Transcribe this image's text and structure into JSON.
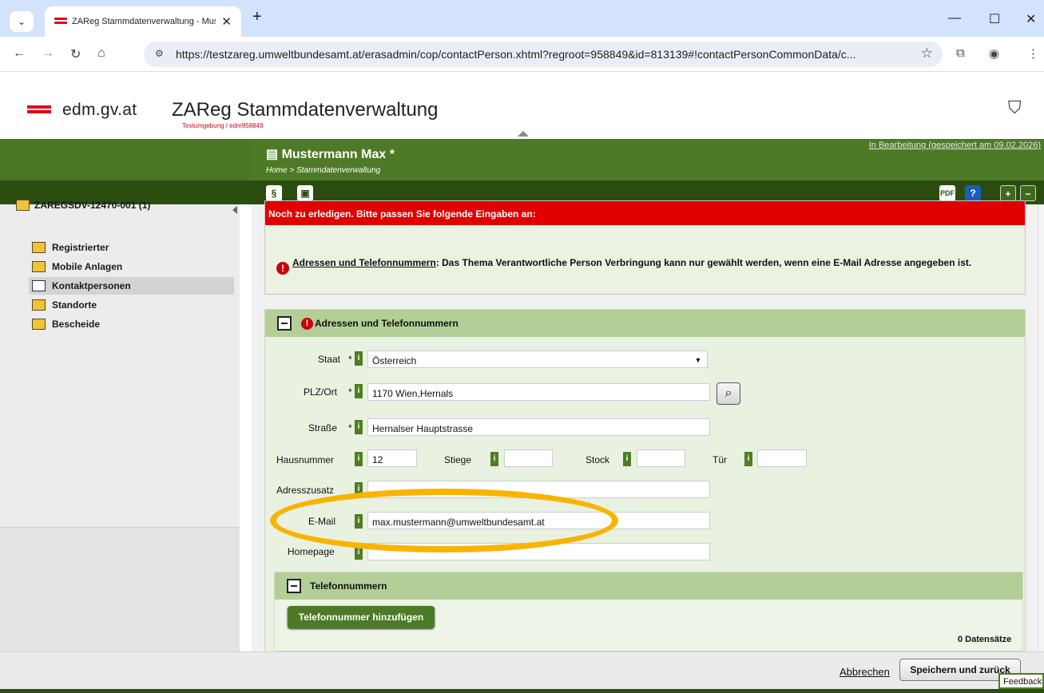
{
  "browser": {
    "tab_title": "ZAReg Stammdatenverwaltung - Must",
    "url": "https://testzareg.umweltbundesamt.at/erasadmin/cop/contactPerson.xhtml?regroot=958849&id=813139#!contactPersonCommonData/c..."
  },
  "header": {
    "brand": "edm.gv.at",
    "app_title": "ZAReg Stammdatenverwaltung",
    "app_subtitle": "Testumgebung / edm958849"
  },
  "page": {
    "title": "Mustermann Max *",
    "breadcrumb": "Home > Stammdatenverwaltung",
    "status": "In Bearbeitung (gespeichert am 09.02.2026)"
  },
  "toolbar": {
    "paragraph_icon": "paragraph-icon",
    "save_icon": "save-icon",
    "pdf_icon": "pdf-icon",
    "help_icon": "help-icon",
    "expand_icon": "expand-icon",
    "collapse_icon": "collapse-icon"
  },
  "sidebar": {
    "root": "ZAREGSDV-12470-001 (1)",
    "items": [
      {
        "label": "Registrierter"
      },
      {
        "label": "Mobile Anlagen"
      },
      {
        "label": "Kontaktpersonen"
      },
      {
        "label": "Standorte"
      },
      {
        "label": "Bescheide"
      }
    ]
  },
  "error": {
    "heading": "Noch zu erledigen. Bitte passen Sie folgende Eingaben an:",
    "link": "Adressen und Telefonnummern",
    "message": ": Das Thema Verantwortliche Person Verbringung kann nur gewählt werden, wenn eine E-Mail Adresse angegeben ist."
  },
  "address_panel": {
    "title": "Adressen und Telefonnummern",
    "fields": {
      "staat": {
        "label": "Staat",
        "value": "Österreich"
      },
      "plz_ort": {
        "label": "PLZ/Ort",
        "value": "1170 Wien,Hernals"
      },
      "strasse": {
        "label": "Straße",
        "value": "Hernalser Hauptstrasse"
      },
      "hausnummer": {
        "label": "Hausnummer",
        "value": "12"
      },
      "stiege": {
        "label": "Stiege",
        "value": ""
      },
      "stock": {
        "label": "Stock",
        "value": ""
      },
      "tuer": {
        "label": "Tür",
        "value": ""
      },
      "adresszusatz": {
        "label": "Adresszusatz",
        "value": ""
      },
      "email": {
        "label": "E-Mail",
        "value": "max.mustermann@umweltbundesamt.at"
      },
      "homepage": {
        "label": "Homepage",
        "value": ""
      }
    }
  },
  "phones": {
    "title": "Telefonnummern",
    "add_button": "Telefonnummer hinzufügen",
    "count": "0 Datensätze"
  },
  "footer": {
    "cancel": "Abbrechen",
    "save": "Speichern und zurück",
    "feedback": "Feedback"
  },
  "colors": {
    "green_dark": "#2a4d0f",
    "green": "#4e7a27",
    "panel_head": "#b3cf97",
    "error_red": "#e00000",
    "highlight": "#f8b400"
  }
}
